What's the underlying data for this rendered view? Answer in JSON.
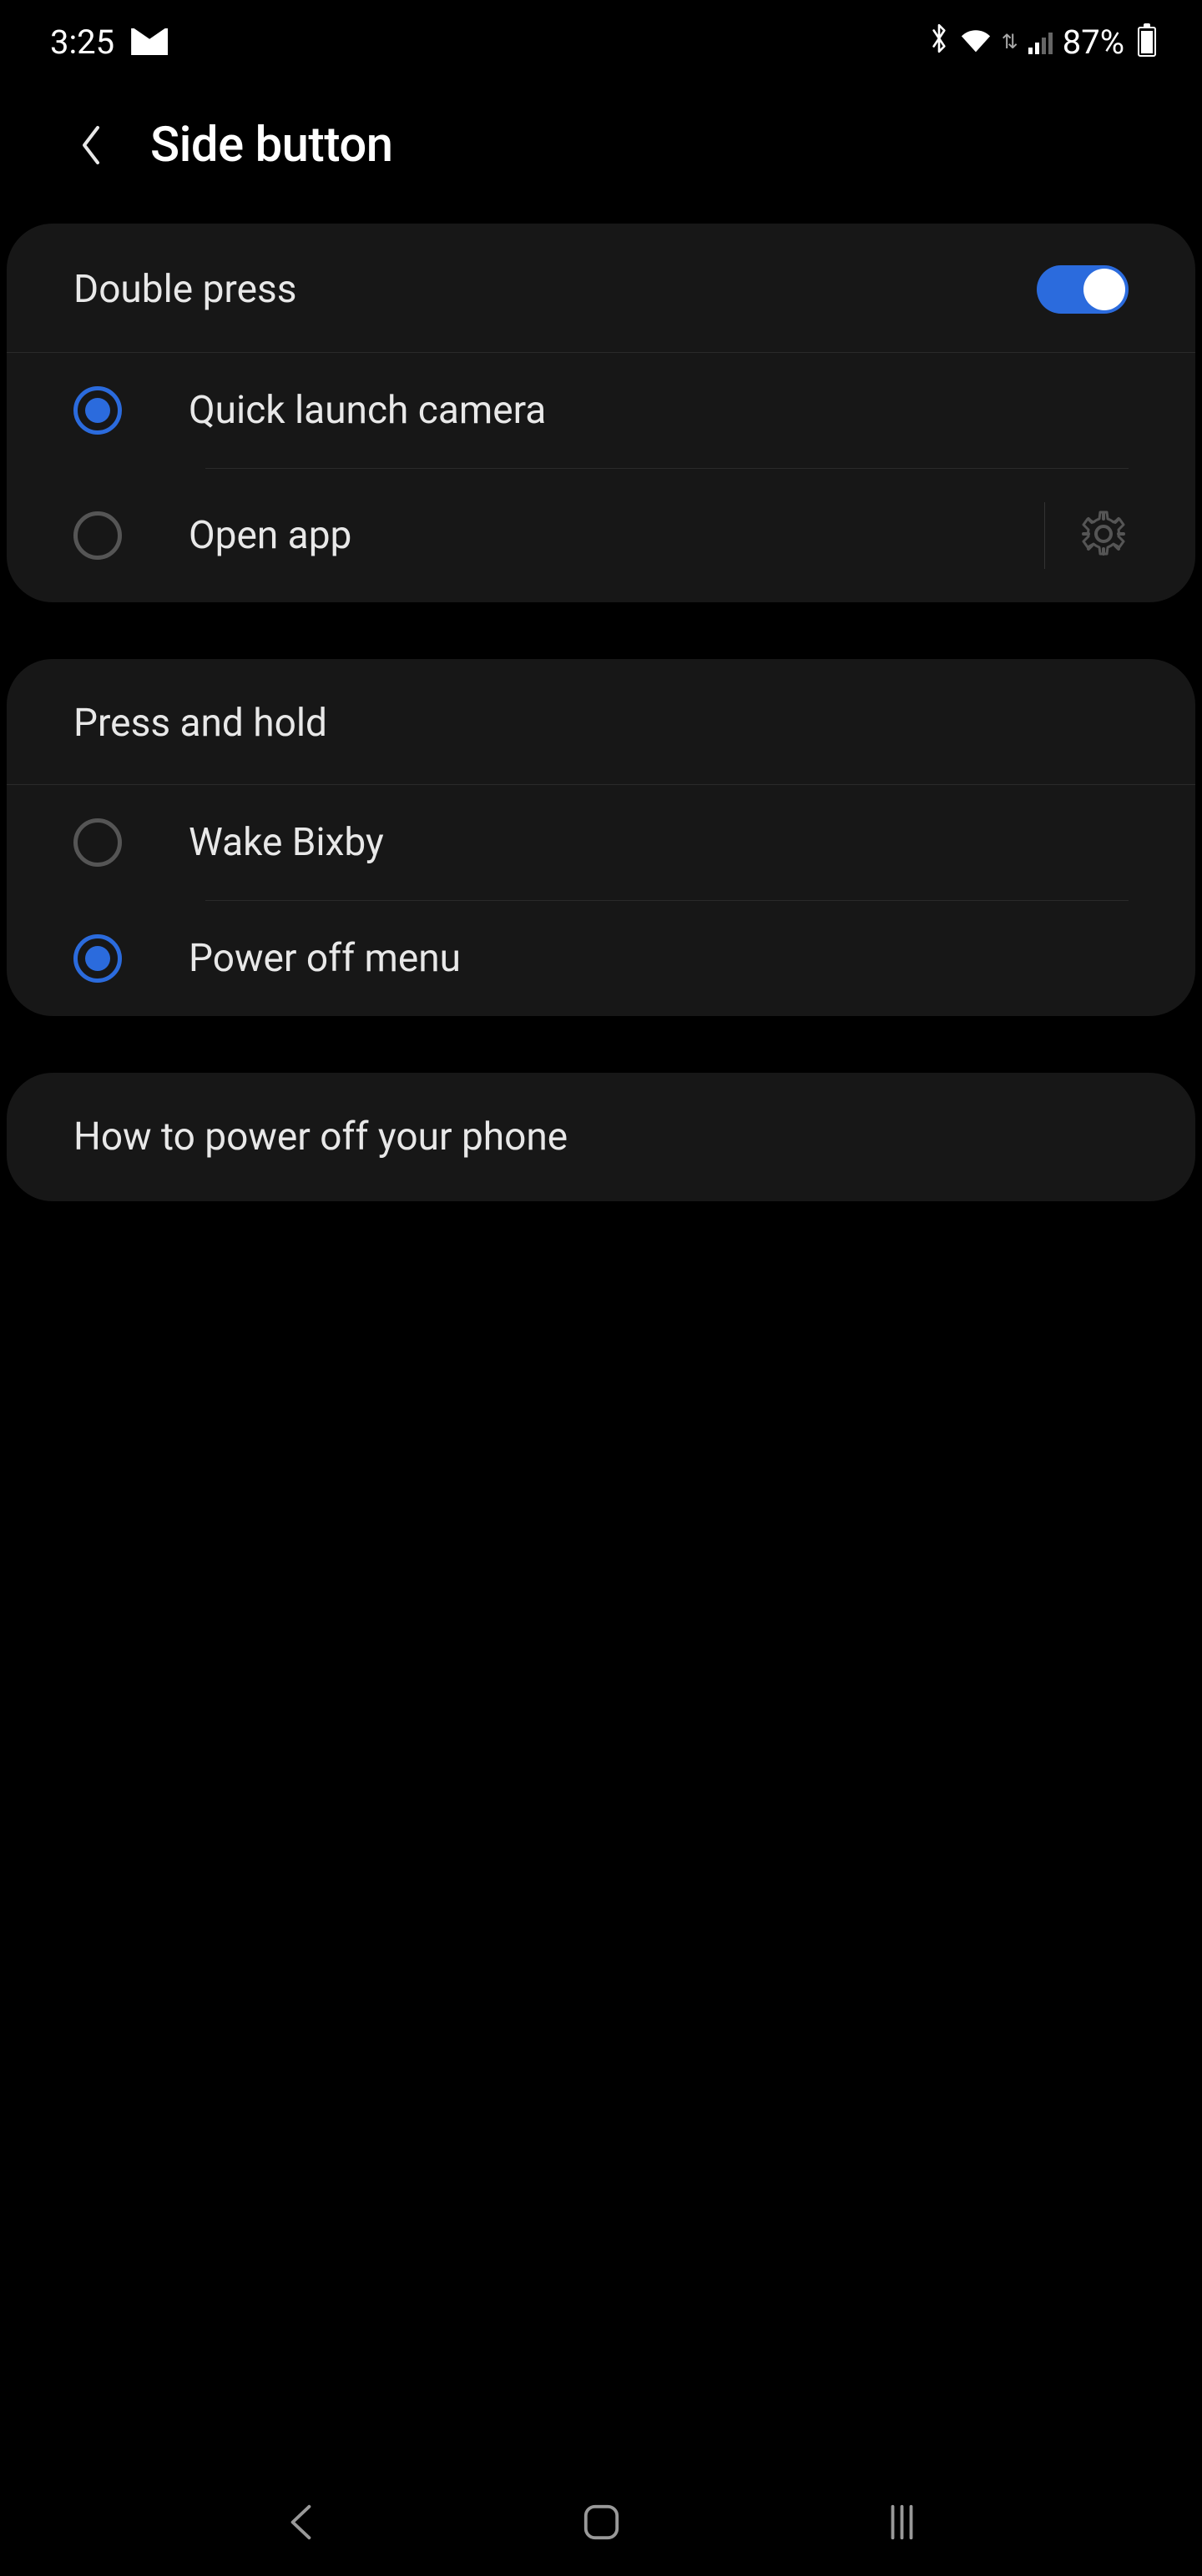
{
  "status_bar": {
    "time": "3:25",
    "battery_percent": "87%"
  },
  "header": {
    "title": "Side button"
  },
  "sections": {
    "double_press": {
      "title": "Double press",
      "toggle_on": true,
      "options": [
        {
          "label": "Quick launch camera",
          "selected": true
        },
        {
          "label": "Open app",
          "selected": false
        }
      ]
    },
    "press_hold": {
      "title": "Press and hold",
      "options": [
        {
          "label": "Wake Bixby",
          "selected": false
        },
        {
          "label": "Power off menu",
          "selected": true
        }
      ]
    }
  },
  "info": {
    "text": "How to power off your phone"
  }
}
